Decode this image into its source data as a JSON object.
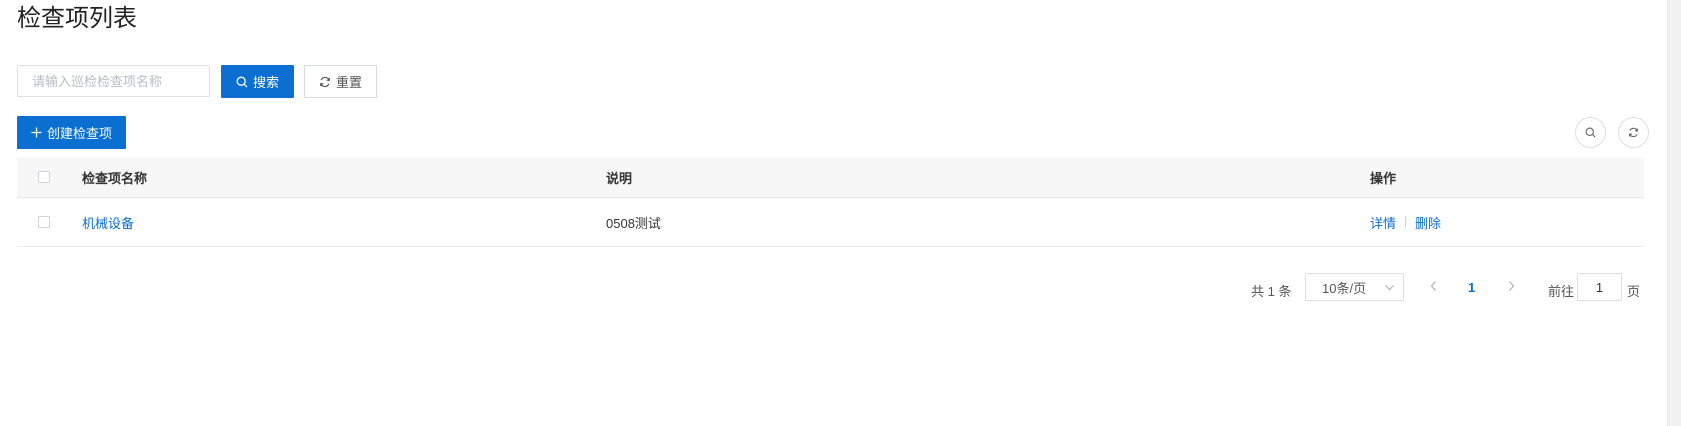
{
  "page": {
    "title": "检查项列表"
  },
  "search": {
    "placeholder": "请输入巡检检查项名称",
    "value": "",
    "search_label": "搜索",
    "reset_label": "重置"
  },
  "toolbar": {
    "create_label": "创建检查项"
  },
  "table": {
    "columns": {
      "name": "检查项名称",
      "description": "说明",
      "actions": "操作"
    },
    "rows": [
      {
        "name": "机械设备",
        "description": "0508测试",
        "detail_label": "详情",
        "delete_label": "删除"
      }
    ]
  },
  "pagination": {
    "total_text": "共 1 条",
    "page_size": "10条/页",
    "current_page": "1",
    "goto_label": "前往",
    "goto_value": "1",
    "goto_unit": "页"
  },
  "colors": {
    "primary": "#0a6fd1"
  }
}
